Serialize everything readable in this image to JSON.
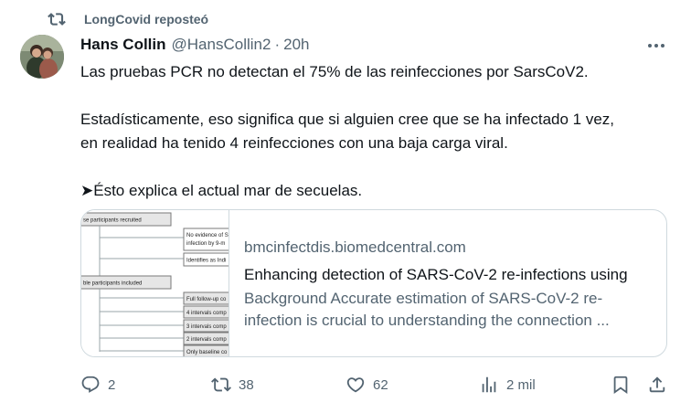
{
  "repost": {
    "label": "LongCovid reposteó",
    "icon": "repost-icon"
  },
  "tweet": {
    "author_name": "Hans Collin",
    "author_handle": "@HansCollin2",
    "separator": "·",
    "time": "20h",
    "text_lines": [
      "Las pruebas PCR no detectan el 75% de las reinfecciones por SarsCoV2.",
      "Estadísticamente, eso significa que si alguien cree que se ha infectado 1 vez,",
      "en realidad ha tenido 4 reinfecciones con una baja carga viral.",
      "➤Ésto explica el actual mar de secuelas."
    ]
  },
  "card": {
    "domain": "bmcinfectdis.biomedcentral.com",
    "title": "Enhancing detection of SARS-CoV-2 re-infections using",
    "description": "Background Accurate estimation of SARS-CoV-2 re-infection is crucial to understanding the connection ...",
    "thumbnail_labels": {
      "box1": "se participants recruited",
      "box2a": "No evidence of S",
      "box2b": "infection by 9-m",
      "box3": "Identifies as Indi",
      "box4": "ble participants included",
      "box5": "Full follow-up co",
      "box6": "4 intervals comp",
      "box7": "3 intervals comp",
      "box8": "2 intervals comp",
      "box9": "Only baseline co"
    }
  },
  "actions": {
    "replies": "2",
    "reposts": "38",
    "likes": "62",
    "views": "2 mil"
  },
  "colors": {
    "text": "#0f1419",
    "secondary": "#536471",
    "border": "#cfd9de"
  }
}
